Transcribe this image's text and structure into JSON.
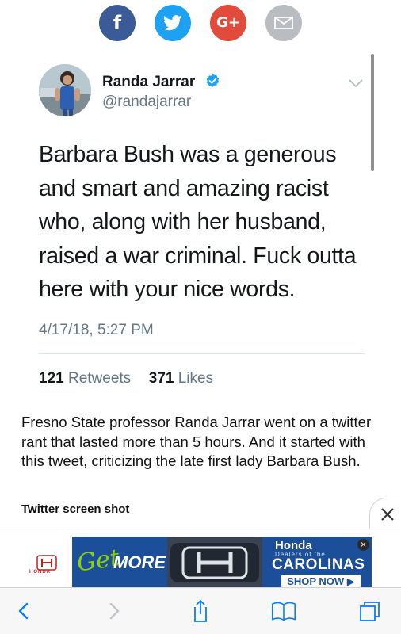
{
  "share_bar": {
    "facebook_glyph": "f",
    "googleplus_glyph": "G+",
    "icons": [
      "facebook-icon",
      "twitter-icon",
      "google-plus-icon",
      "email-icon"
    ],
    "colors": {
      "facebook": "#3b5b98",
      "twitter": "#1da1f2",
      "googleplus": "#e24b3b",
      "email": "#b9bcc0"
    }
  },
  "tweet": {
    "author_name": "Randa Jarrar",
    "handle": "@randajarrar",
    "text": "Barbara Bush was a generous and smart and amazing racist who, along with her husband, raised a war criminal. Fuck outta here with your nice words.",
    "timestamp": "4/17/18, 5:27 PM",
    "retweets_count": "121",
    "retweets_label": "Retweets",
    "likes_count": "371",
    "likes_label": "Likes",
    "verified_color": "#1da1f2"
  },
  "article": {
    "caption": "Fresno State professor Randa Jarrar went on a twitter rant that lasted more than 5 hours. And it started with this tweet, criticizing the late first lady Barbara Bush.",
    "credit": "Twitter screen shot"
  },
  "ad": {
    "brand_small": "HONDA",
    "get": "Get",
    "more": "MORE",
    "right_title": "Honda",
    "right_sub": "Dealers of the",
    "right_big": "CAROLINAS",
    "cta": "SHOP NOW ▶",
    "close_glyph": "×"
  },
  "toolbar": {
    "icons": [
      "back-icon",
      "forward-icon",
      "share-icon",
      "bookmarks-icon",
      "tabs-icon"
    ],
    "accent": "#0a7aff"
  }
}
